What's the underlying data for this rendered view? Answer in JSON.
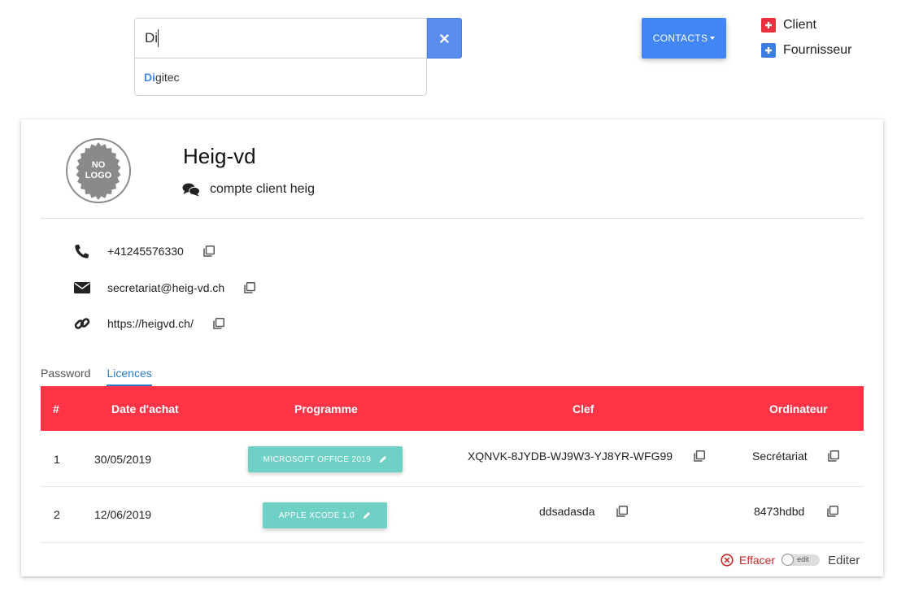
{
  "search": {
    "value": "Di",
    "clear_icon": "close-icon"
  },
  "suggestions": [
    {
      "match": "Di",
      "rest": "gitec"
    }
  ],
  "contacts_button": {
    "label": "CONTACTS"
  },
  "legend": [
    {
      "label": "Client",
      "color": "#e8303f",
      "icon": "plus-square-icon"
    },
    {
      "label": "Fournisseur",
      "color": "#3d7ee0",
      "icon": "plus-square-icon"
    }
  ],
  "company": {
    "logo_text_line1": "NO",
    "logo_text_line2": "LOGO",
    "name": "Heig-vd",
    "comment": "compte client heig"
  },
  "contact_info": {
    "phone": "+41245576330",
    "email": "secretariat@heig-vd.ch",
    "website": "https://heigvd.ch/"
  },
  "tabs": [
    {
      "label": "Password",
      "active": false
    },
    {
      "label": "Licences",
      "active": true
    }
  ],
  "table": {
    "header_color": "#ff3547",
    "columns": [
      "#",
      "Date d'achat",
      "Programme",
      "Clef",
      "Ordinateur"
    ],
    "rows": [
      {
        "num": "1",
        "date": "30/05/2019",
        "program": "MICROSOFT OFFICE 2019",
        "key": "XQNVK-8JYDB-WJ9W3-YJ8YR-WFG99",
        "computer": "Secrétariat"
      },
      {
        "num": "2",
        "date": "12/06/2019",
        "program": "APPLE XCODE 1.0",
        "key": "ddsadasda",
        "computer": "8473hdbd"
      }
    ]
  },
  "footer": {
    "delete_label": "Effacer",
    "toggle_label": "edit",
    "edit_label": "Editer"
  },
  "colors": {
    "primary": "#4285f4",
    "accent_red": "#ff3547",
    "program_button": "#6fd0c5",
    "tab_active": "#2a7bc4"
  }
}
